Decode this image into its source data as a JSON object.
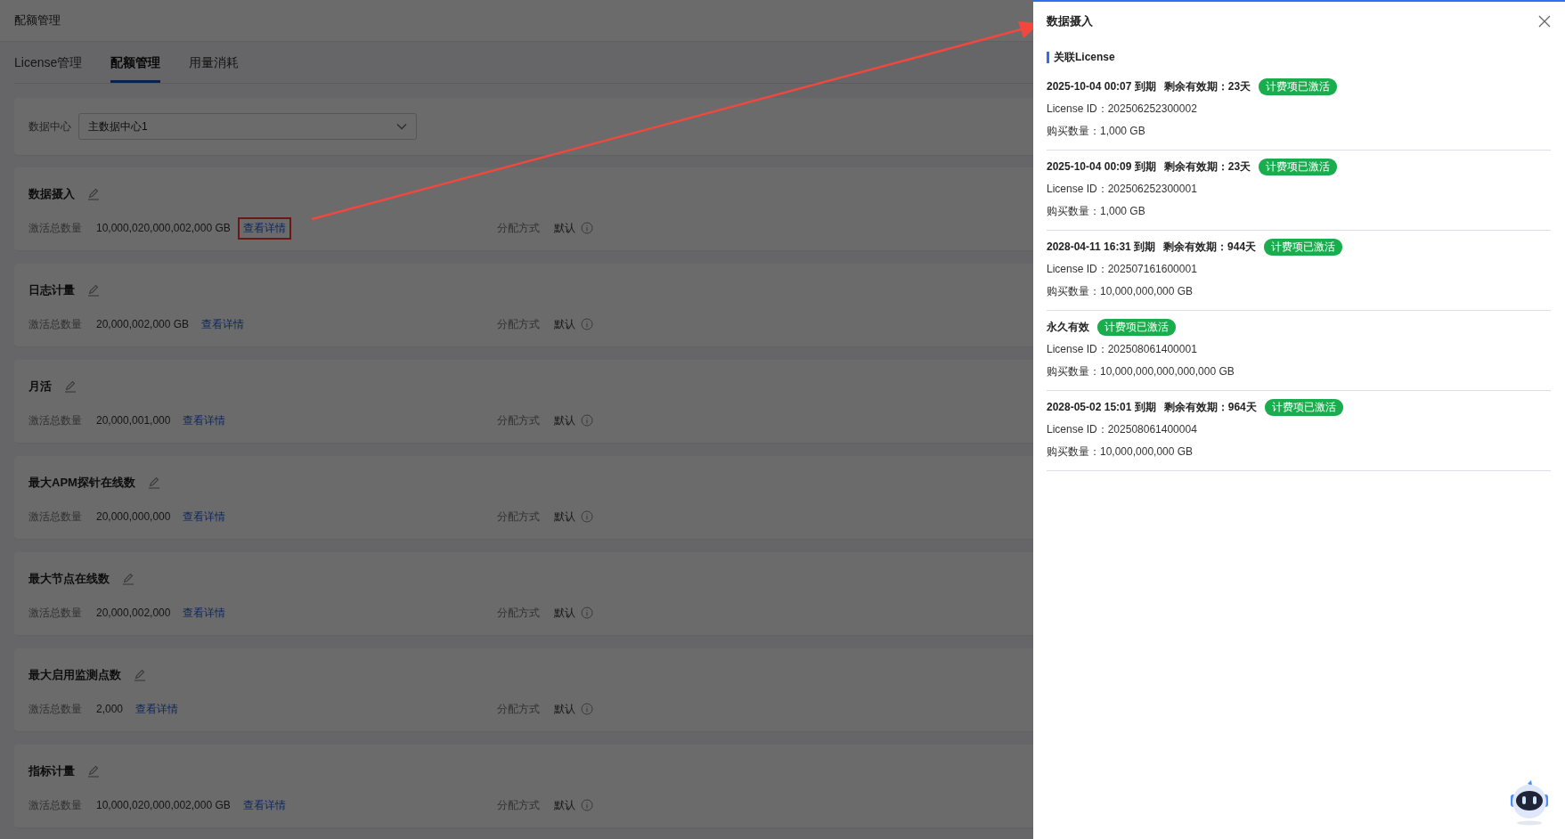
{
  "page_title": "配额管理",
  "tabs": [
    {
      "label": "License管理",
      "selected": false
    },
    {
      "label": "配额管理",
      "selected": true
    },
    {
      "label": "用量消耗",
      "selected": false
    }
  ],
  "filter": {
    "label": "数据中心",
    "value": "主数据中心1"
  },
  "quotas": [
    {
      "name": "数据摄入",
      "total_label": "激活总数量",
      "total": "10,000,020,000,002,000 GB",
      "link": "查看详情",
      "highlighted": true,
      "mode_label": "分配方式",
      "mode": "默认"
    },
    {
      "name": "日志计量",
      "total_label": "激活总数量",
      "total": "20,000,002,000 GB",
      "link": "查看详情",
      "highlighted": false,
      "mode_label": "分配方式",
      "mode": "默认"
    },
    {
      "name": "月活",
      "total_label": "激活总数量",
      "total": "20,000,001,000",
      "link": "查看详情",
      "highlighted": false,
      "mode_label": "分配方式",
      "mode": "默认"
    },
    {
      "name": "最大APM探针在线数",
      "total_label": "激活总数量",
      "total": "20,000,000,000",
      "link": "查看详情",
      "highlighted": false,
      "mode_label": "分配方式",
      "mode": "默认"
    },
    {
      "name": "最大节点在线数",
      "total_label": "激活总数量",
      "total": "20,000,002,000",
      "link": "查看详情",
      "highlighted": false,
      "mode_label": "分配方式",
      "mode": "默认"
    },
    {
      "name": "最大启用监测点数",
      "total_label": "激活总数量",
      "total": "2,000",
      "link": "查看详情",
      "highlighted": false,
      "mode_label": "分配方式",
      "mode": "默认"
    },
    {
      "name": "指标计量",
      "total_label": "激活总数量",
      "total": "10,000,020,000,002,000 GB",
      "link": "查看详情",
      "highlighted": false,
      "mode_label": "分配方式",
      "mode": "默认"
    }
  ],
  "drawer": {
    "title": "数据摄入",
    "section": "关联License",
    "licenses": [
      {
        "expiry": "2025-10-04 00:07 到期",
        "remaining": "剩余有效期：23天",
        "status": "计费项已激活",
        "id": "License ID：202506252300002",
        "amount": "购买数量：1,000 GB"
      },
      {
        "expiry": "2025-10-04 00:09 到期",
        "remaining": "剩余有效期：23天",
        "status": "计费项已激活",
        "id": "License ID：202506252300001",
        "amount": "购买数量：1,000 GB"
      },
      {
        "expiry": "2028-04-11 16:31 到期",
        "remaining": "剩余有效期：944天",
        "status": "计费项已激活",
        "id": "License ID：202507161600001",
        "amount": "购买数量：10,000,000,000 GB"
      },
      {
        "expiry": "永久有效",
        "status": "计费项已激活",
        "id": "License ID：202508061400001",
        "amount": "购买数量：10,000,000,000,000,000 GB"
      },
      {
        "expiry": "2028-05-02 15:01 到期",
        "remaining": "剩余有效期：964天",
        "status": "计费项已激活",
        "id": "License ID：202508061400004",
        "amount": "购买数量：10,000,000,000 GB"
      }
    ]
  }
}
